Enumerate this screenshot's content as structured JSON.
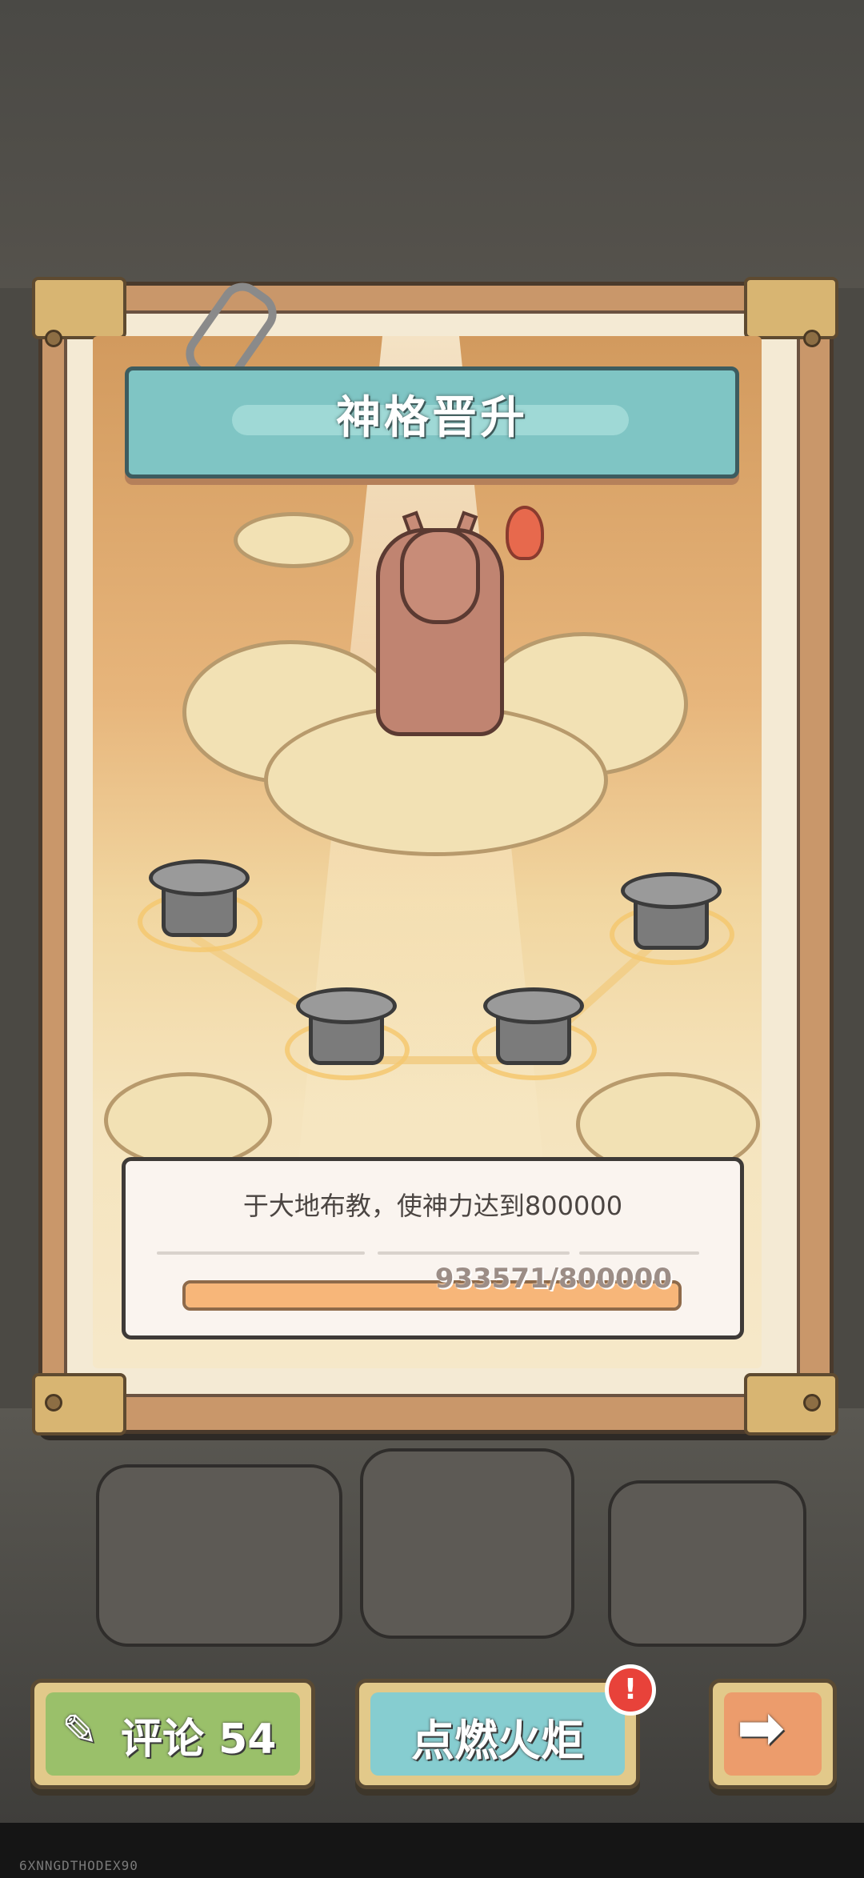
{
  "header": {
    "title": "神格晋升"
  },
  "quest": {
    "description": "于大地布教，使神力达到800000",
    "progress_text": "933571/800000",
    "progress_fraction": 1.0
  },
  "bottom_bar": {
    "comment_label": "评论 54",
    "ignite_label": "点燃火炬",
    "ignite_badge": "!",
    "next_icon": "arrow-right-icon"
  },
  "watermark": "6XNNGDTHODEX90",
  "colors": {
    "banner": "#7fc5c4",
    "comment_button": "#9ac06a",
    "ignite_button": "#86cdd0",
    "next_button": "#ec9c6c",
    "progress_fill": "#f7b679",
    "badge": "#e8423a"
  }
}
